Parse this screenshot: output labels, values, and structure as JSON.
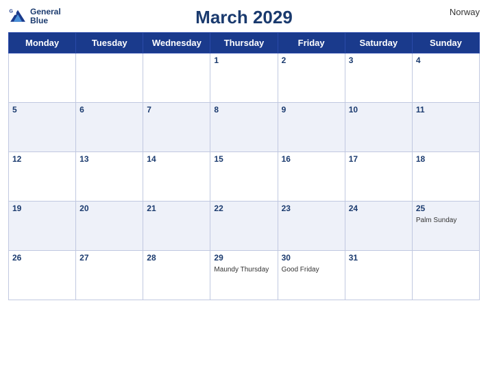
{
  "title": "March 2029",
  "country": "Norway",
  "logo": {
    "line1": "General",
    "line2": "Blue"
  },
  "weekdays": [
    "Monday",
    "Tuesday",
    "Wednesday",
    "Thursday",
    "Friday",
    "Saturday",
    "Sunday"
  ],
  "weeks": [
    [
      {
        "day": "",
        "event": ""
      },
      {
        "day": "",
        "event": ""
      },
      {
        "day": "",
        "event": ""
      },
      {
        "day": "1",
        "event": ""
      },
      {
        "day": "2",
        "event": ""
      },
      {
        "day": "3",
        "event": ""
      },
      {
        "day": "4",
        "event": ""
      }
    ],
    [
      {
        "day": "5",
        "event": ""
      },
      {
        "day": "6",
        "event": ""
      },
      {
        "day": "7",
        "event": ""
      },
      {
        "day": "8",
        "event": ""
      },
      {
        "day": "9",
        "event": ""
      },
      {
        "day": "10",
        "event": ""
      },
      {
        "day": "11",
        "event": ""
      }
    ],
    [
      {
        "day": "12",
        "event": ""
      },
      {
        "day": "13",
        "event": ""
      },
      {
        "day": "14",
        "event": ""
      },
      {
        "day": "15",
        "event": ""
      },
      {
        "day": "16",
        "event": ""
      },
      {
        "day": "17",
        "event": ""
      },
      {
        "day": "18",
        "event": ""
      }
    ],
    [
      {
        "day": "19",
        "event": ""
      },
      {
        "day": "20",
        "event": ""
      },
      {
        "day": "21",
        "event": ""
      },
      {
        "day": "22",
        "event": ""
      },
      {
        "day": "23",
        "event": ""
      },
      {
        "day": "24",
        "event": ""
      },
      {
        "day": "25",
        "event": "Palm Sunday"
      }
    ],
    [
      {
        "day": "26",
        "event": ""
      },
      {
        "day": "27",
        "event": ""
      },
      {
        "day": "28",
        "event": ""
      },
      {
        "day": "29",
        "event": "Maundy Thursday"
      },
      {
        "day": "30",
        "event": "Good Friday"
      },
      {
        "day": "31",
        "event": ""
      },
      {
        "day": "",
        "event": ""
      }
    ]
  ]
}
